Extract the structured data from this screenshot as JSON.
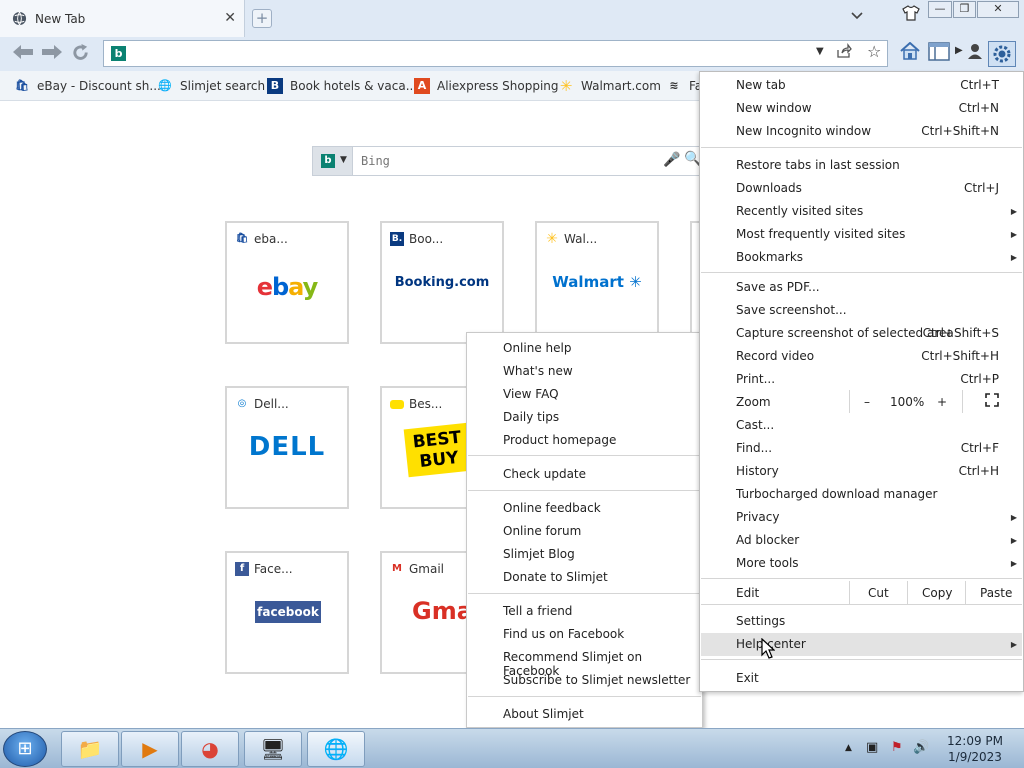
{
  "browser": {
    "tab_title": "New Tab",
    "tab_close": "✕",
    "new_tab_glyph": "+",
    "window_controls": [
      "—",
      "❐",
      "✕"
    ],
    "address_value": "",
    "icons": [
      "globe-icon",
      "back-icon",
      "forward-icon",
      "reload-icon",
      "bing-icon",
      "share-icon",
      "star-icon",
      "home-icon",
      "sidebar-icon",
      "user-icon",
      "gear-icon"
    ]
  },
  "bookmarks": [
    {
      "label": "eBay - Discount sh...",
      "icon": "🛍",
      "color": "#1a4fa0"
    },
    {
      "label": "Slimjet search",
      "icon": "🌐",
      "color": "#2b6cc4"
    },
    {
      "label": "Book hotels & vaca...",
      "icon": "B",
      "color": "#0a3a80"
    },
    {
      "label": "Aliexpress Shopping",
      "icon": "A",
      "color": "#e04a1f"
    },
    {
      "label": "Walmart.com",
      "icon": "✳",
      "color": "#ffc220"
    },
    {
      "label": "Fa",
      "icon": "≋",
      "color": "#333333"
    }
  ],
  "search": {
    "engine_letter": "b",
    "placeholder": "Bing",
    "mic": "🎤",
    "magnifier": "🔍"
  },
  "tiles": [
    {
      "label": "eba...",
      "logo": "ebay",
      "icon": "🛍"
    },
    {
      "label": "Boo...",
      "logo": "Booking.com",
      "icon": "B."
    },
    {
      "label": "Wal...",
      "logo": "Walmart ✳",
      "icon": "✳"
    },
    {
      "label": "Dell...",
      "logo": "DELL",
      "icon": "◎"
    },
    {
      "label": "Bes...",
      "logo": "BEST BUY",
      "icon": "▬"
    },
    {
      "label": "Face...",
      "logo": "facebook",
      "icon": "f"
    },
    {
      "label": "Gmail",
      "logo": "Gmai",
      "icon": "M"
    }
  ],
  "help_submenu": {
    "groups": [
      [
        "Online help",
        "What's new",
        "View FAQ",
        "Daily tips",
        "Product homepage"
      ],
      [
        "Check update"
      ],
      [
        "Online feedback",
        "Online forum",
        "Slimjet Blog",
        "Donate to Slimjet"
      ],
      [
        "Tell a friend",
        "Find us on Facebook",
        "Recommend Slimjet on Facebook",
        "Subscribe to Slimjet newsletter"
      ],
      [
        "About Slimjet"
      ]
    ]
  },
  "main_menu": {
    "new_tab": "New tab",
    "new_tab_sc": "Ctrl+T",
    "new_window": "New window",
    "new_window_sc": "Ctrl+N",
    "new_incognito": "New Incognito window",
    "new_incognito_sc": "Ctrl+Shift+N",
    "restore_tabs": "Restore tabs in last session",
    "downloads": "Downloads",
    "downloads_sc": "Ctrl+J",
    "recently_visited": "Recently visited sites",
    "most_frequent": "Most frequently visited sites",
    "bookmarks": "Bookmarks",
    "save_pdf": "Save as PDF...",
    "save_screenshot": "Save screenshot...",
    "capture_selected": "Capture screenshot of selected area",
    "capture_selected_sc": "Ctrl+Shift+S",
    "record_video": "Record video",
    "record_video_sc": "Ctrl+Shift+H",
    "print": "Print...",
    "print_sc": "Ctrl+P",
    "zoom": "Zoom",
    "zoom_minus": "–",
    "zoom_value": "100%",
    "zoom_plus": "+",
    "cast": "Cast...",
    "find": "Find...",
    "find_sc": "Ctrl+F",
    "history": "History",
    "history_sc": "Ctrl+H",
    "turbo_dl": "Turbocharged download manager",
    "privacy": "Privacy",
    "ad_blocker": "Ad blocker",
    "more_tools": "More tools",
    "edit": "Edit",
    "cut": "Cut",
    "copy": "Copy",
    "paste": "Paste",
    "settings": "Settings",
    "help_center": "Help center",
    "exit": "Exit",
    "arrow": "▶"
  },
  "taskbar": {
    "start_glyph": "⊞",
    "apps": [
      "📁",
      "▶",
      "◕",
      "🖥",
      "🌐"
    ],
    "tray": [
      "▲",
      "▣",
      "⚑",
      "🔊"
    ],
    "time": "12:09 PM",
    "date": "1/9/2023"
  }
}
